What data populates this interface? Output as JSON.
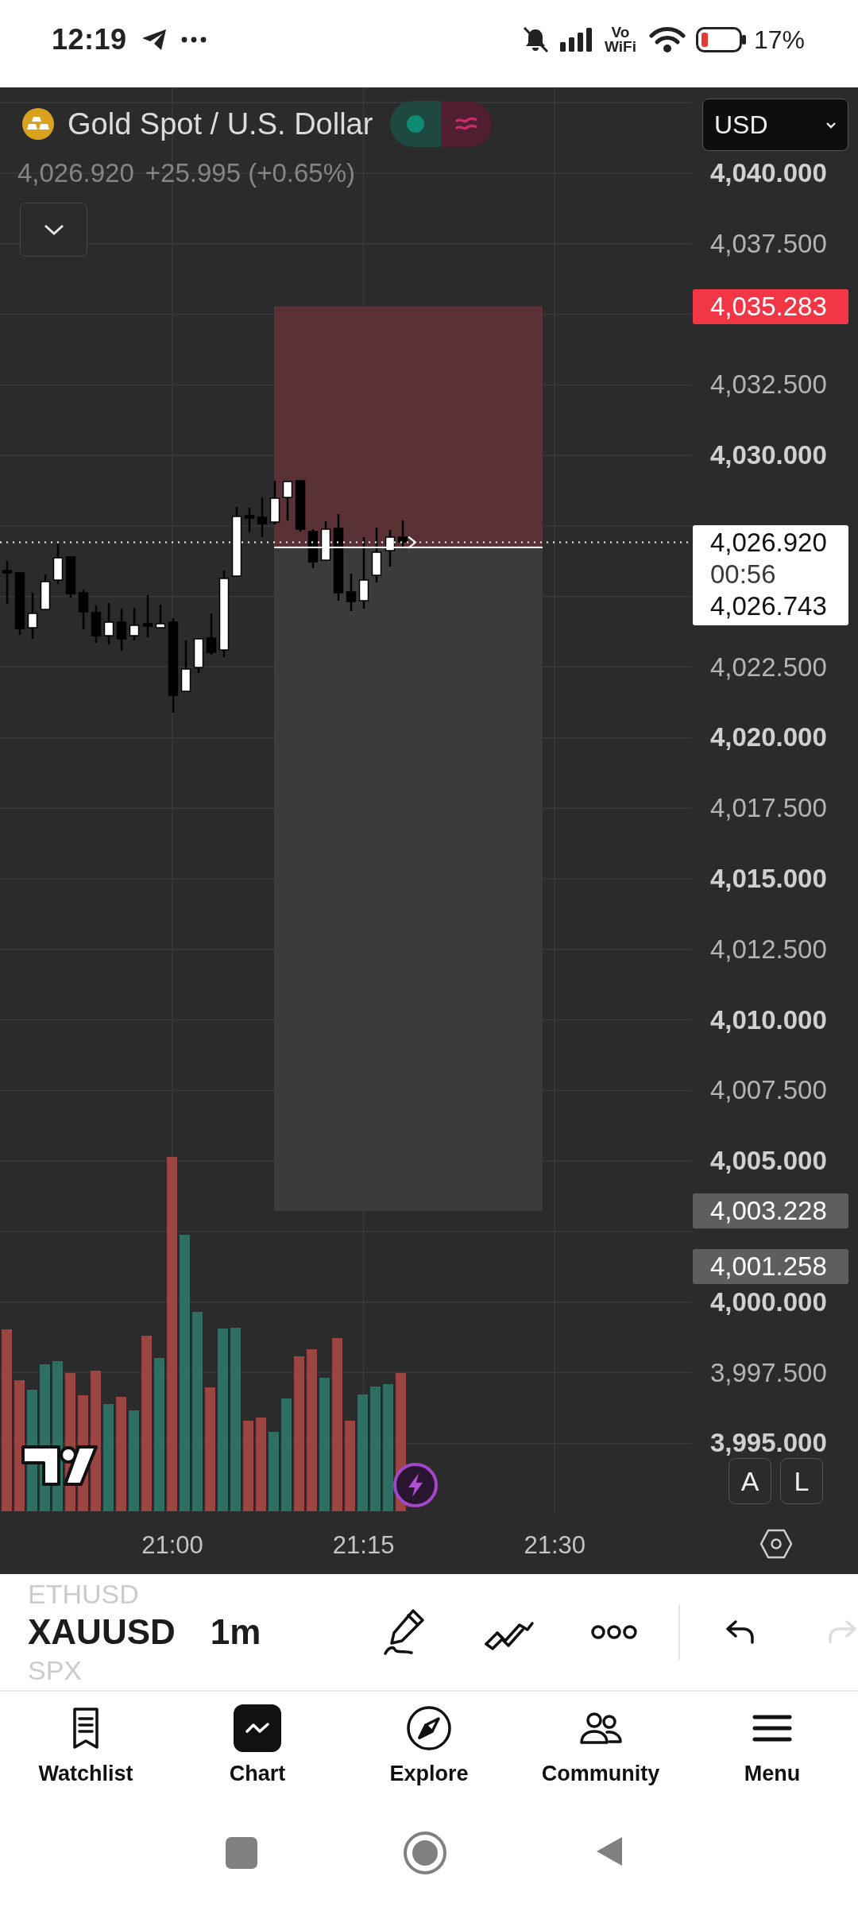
{
  "status_bar": {
    "time": "12:19",
    "network_label": "Vo WiFi",
    "battery": "17%"
  },
  "symbol": {
    "name": "Gold Spot / U.S. Dollar",
    "price": "4,026.920",
    "change": "+25.995 (+0.65%)"
  },
  "currency": "USD",
  "price_axis": {
    "ticks": [
      {
        "label": "4,040.000",
        "major": true
      },
      {
        "label": "4,037.500",
        "major": false
      },
      {
        "label": "4,032.500",
        "major": false
      },
      {
        "label": "4,030.000",
        "major": true
      },
      {
        "label": "4,022.500",
        "major": false
      },
      {
        "label": "4,020.000",
        "major": true
      },
      {
        "label": "4,017.500",
        "major": false
      },
      {
        "label": "4,015.000",
        "major": true
      },
      {
        "label": "4,012.500",
        "major": false
      },
      {
        "label": "4,010.000",
        "major": true
      },
      {
        "label": "4,007.500",
        "major": false
      },
      {
        "label": "4,005.000",
        "major": true
      },
      {
        "label": "4,000.000",
        "major": true
      },
      {
        "label": "3,997.500",
        "major": false
      },
      {
        "label": "3,995.000",
        "major": true
      }
    ]
  },
  "price_labels": [
    {
      "kind": "stop",
      "text": "4,035.283"
    },
    {
      "kind": "target",
      "text": "4,003.228"
    },
    {
      "kind": "level",
      "text": "4,001.258"
    }
  ],
  "last_price": {
    "price": "4,026.920",
    "countdown": "00:56",
    "entry": "4,026.743"
  },
  "scale_buttons": [
    "A",
    "L"
  ],
  "time_axis": [
    "21:00",
    "21:15",
    "21:30"
  ],
  "toolbar": {
    "symbols": [
      {
        "label": "ETHUSD",
        "selected": false
      },
      {
        "label": "XAUUSD",
        "selected": true
      },
      {
        "label": "SPX",
        "selected": false
      }
    ],
    "interval": "1m",
    "history": [
      {
        "kind": "undo",
        "disabled": false
      },
      {
        "kind": "redo",
        "disabled": true
      }
    ]
  },
  "nav": [
    {
      "label": "Watchlist",
      "selected": false
    },
    {
      "label": "Chart",
      "selected": true
    },
    {
      "label": "Explore",
      "selected": false
    },
    {
      "label": "Community",
      "selected": false
    },
    {
      "label": "Menu",
      "selected": false
    }
  ]
}
